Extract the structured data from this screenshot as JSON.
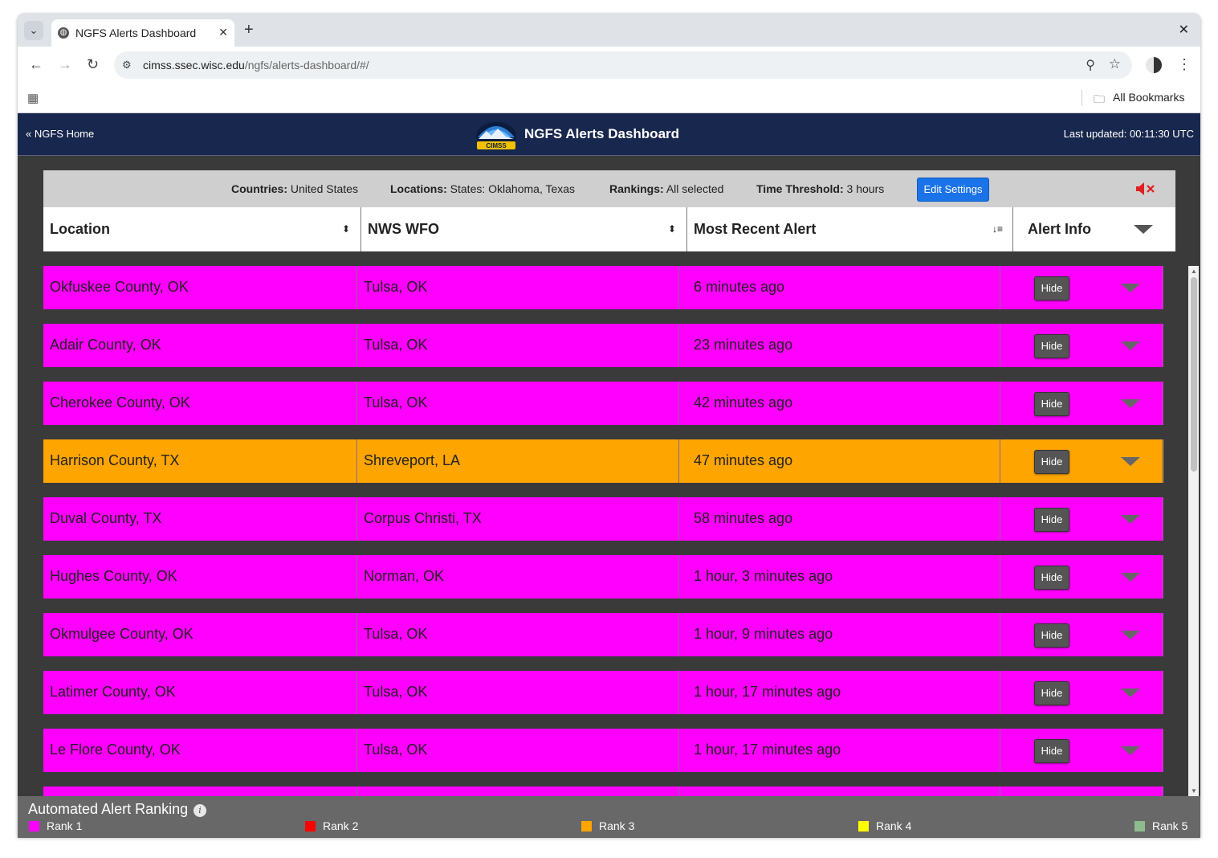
{
  "browser": {
    "tab_title": "NGFS Alerts Dashboard",
    "url_host": "cimss.ssec.wisc.edu",
    "url_path": "/ngfs/alerts-dashboard/#/",
    "bookmarks_label": "All Bookmarks"
  },
  "nav": {
    "home_link": "« NGFS Home",
    "logo_text": "CIMSS",
    "title": "NGFS Alerts Dashboard",
    "last_updated": "Last updated: 00:11:30 UTC"
  },
  "filters": {
    "countries_label": "Countries:",
    "countries_value": "United States",
    "locations_label": "Locations:",
    "locations_value": "States: Oklahoma, Texas",
    "rankings_label": "Rankings:",
    "rankings_value": "All selected",
    "time_label": "Time Threshold:",
    "time_value": "3 hours",
    "edit_button": "Edit Settings"
  },
  "table": {
    "headers": [
      "Location",
      "NWS WFO",
      "Most Recent Alert",
      "Alert Info"
    ],
    "hide_label": "Hide",
    "rows": [
      {
        "location": "Okfuskee County, OK",
        "wfo": "Tulsa, OK",
        "recent": "6 minutes ago",
        "color": "#ff00ff"
      },
      {
        "location": "Adair County, OK",
        "wfo": "Tulsa, OK",
        "recent": "23 minutes ago",
        "color": "#ff00ff"
      },
      {
        "location": "Cherokee County, OK",
        "wfo": "Tulsa, OK",
        "recent": "42 minutes ago",
        "color": "#ff00ff"
      },
      {
        "location": "Harrison County, TX",
        "wfo": "Shreveport, LA",
        "recent": "47 minutes ago",
        "color": "#ffa500"
      },
      {
        "location": "Duval County, TX",
        "wfo": "Corpus Christi, TX",
        "recent": "58 minutes ago",
        "color": "#ff00ff"
      },
      {
        "location": "Hughes County, OK",
        "wfo": "Norman, OK",
        "recent": "1 hour, 3 minutes ago",
        "color": "#ff00ff"
      },
      {
        "location": "Okmulgee County, OK",
        "wfo": "Tulsa, OK",
        "recent": "1 hour, 9 minutes ago",
        "color": "#ff00ff"
      },
      {
        "location": "Latimer County, OK",
        "wfo": "Tulsa, OK",
        "recent": "1 hour, 17 minutes ago",
        "color": "#ff00ff"
      },
      {
        "location": "Le Flore County, OK",
        "wfo": "Tulsa, OK",
        "recent": "1 hour, 17 minutes ago",
        "color": "#ff00ff"
      },
      {
        "location": "",
        "wfo": "",
        "recent": "",
        "color": "#ff00ff"
      }
    ]
  },
  "legend": {
    "title": "Automated Alert Ranking",
    "ranks": [
      {
        "label": "Rank 1",
        "color": "#ff00ff"
      },
      {
        "label": "Rank 2",
        "color": "#ff0000"
      },
      {
        "label": "Rank 3",
        "color": "#ffa500"
      },
      {
        "label": "Rank 4",
        "color": "#ffff00"
      },
      {
        "label": "Rank 5",
        "color": "#8fbc8f"
      }
    ]
  }
}
